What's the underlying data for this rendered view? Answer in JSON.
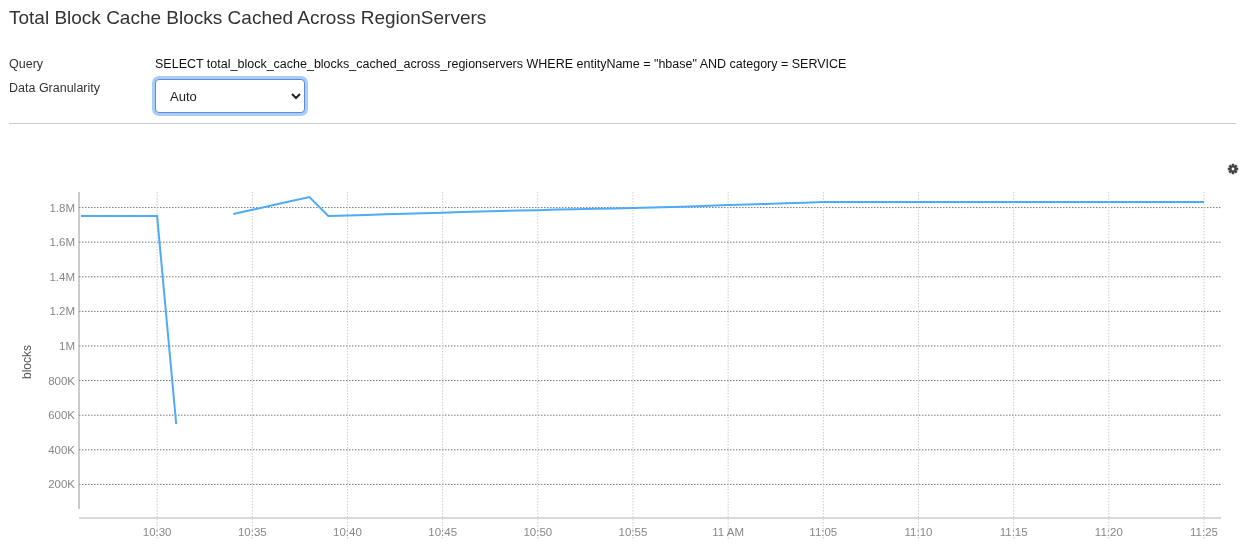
{
  "title": "Total Block Cache Blocks Cached Across RegionServers",
  "fields": [
    {
      "label": "Query",
      "kind": "text",
      "value": "SELECT total_block_cache_blocks_cached_across_regionservers WHERE entityName = \"hbase\" AND category = SERVICE"
    },
    {
      "label": "Data Granularity",
      "kind": "select",
      "value": "Auto",
      "focused": true
    }
  ],
  "chart_data": {
    "type": "line",
    "ylabel": "blocks",
    "grid": true,
    "categories": [
      null,
      null,
      null,
      null,
      "10:30",
      null,
      null,
      null,
      null,
      "10:35",
      null,
      null,
      null,
      null,
      "10:40",
      null,
      null,
      null,
      null,
      "10:45",
      null,
      null,
      null,
      null,
      "10:50",
      null,
      null,
      null,
      null,
      "10:55",
      null,
      null,
      null,
      null,
      "11 AM",
      null,
      null,
      null,
      null,
      "11:05",
      null,
      null,
      null,
      null,
      "11:10",
      null,
      null,
      null,
      null,
      "11:15",
      null,
      null,
      null,
      null,
      "11:20",
      null,
      null,
      null,
      null,
      "11:25"
    ],
    "series": [
      {
        "color": "#4dabf7",
        "values": [
          1751000,
          1751000,
          1751000,
          1751000,
          1751000,
          549000,
          null,
          null,
          1763000,
          1787000,
          1812000,
          1836000,
          1861000,
          1751000,
          1754000,
          1757000,
          1761000,
          1764000,
          1767000,
          1770000,
          1774000,
          1777000,
          1780000,
          1783000,
          1785000,
          1788000,
          1790000,
          1793000,
          1795000,
          1798000,
          1800000,
          1804000,
          1807000,
          1811000,
          1814000,
          1818000,
          1821000,
          1825000,
          1828000,
          1832000,
          1832000,
          1832000,
          1832000,
          1832000,
          1832000,
          1832000,
          1832000,
          1832000,
          1832000,
          1832000,
          1832000,
          1832000,
          1832000,
          1832000,
          1832000,
          1832000,
          1832000,
          1832000,
          1832000,
          1832000
        ]
      }
    ],
    "ylim": [
      0,
      1890000
    ],
    "yticks": [
      {
        "value": 200000,
        "label": "200K"
      },
      {
        "value": 400000,
        "label": "400K"
      },
      {
        "value": 600000,
        "label": "600K"
      },
      {
        "value": 800000,
        "label": "800K"
      },
      {
        "value": 1000000,
        "label": "1M"
      },
      {
        "value": 1200000,
        "label": "1.2M"
      },
      {
        "value": 1400000,
        "label": "1.4M"
      },
      {
        "value": 1600000,
        "label": "1.6M"
      },
      {
        "value": 1800000,
        "label": "1.8M"
      }
    ]
  }
}
